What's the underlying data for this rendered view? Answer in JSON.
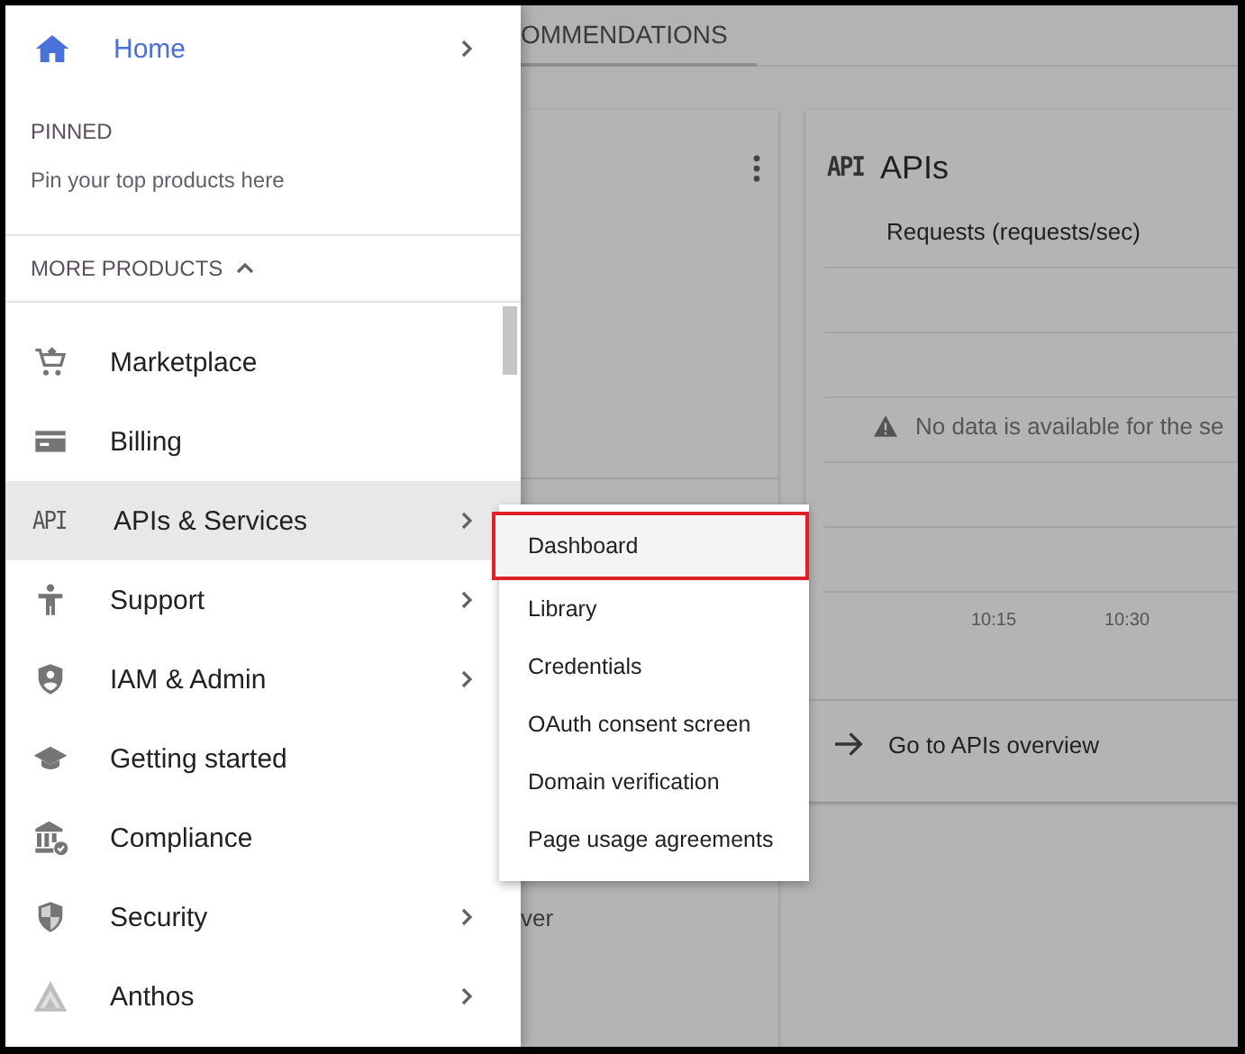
{
  "background": {
    "tab": {
      "label": "OMMENDATIONS",
      "selected": true
    },
    "left_card": {
      "text": "ver"
    },
    "apis_card": {
      "icon_text": "API",
      "title": "APIs",
      "chart_title": "Requests (requests/sec)",
      "message": "No data is available for the se",
      "x_labels": [
        "10:15",
        "10:30"
      ],
      "link": "Go to APIs overview"
    }
  },
  "drawer": {
    "home": {
      "label": "Home"
    },
    "pinned": {
      "heading": "PINNED",
      "hint": "Pin your top products here"
    },
    "more_products": {
      "label": "MORE PRODUCTS",
      "expanded": true
    },
    "items": [
      {
        "label": "Marketplace",
        "kind": "cart",
        "selected": false,
        "has_submenu": false
      },
      {
        "label": "Billing",
        "kind": "card",
        "selected": false,
        "has_submenu": false
      },
      {
        "label": "APIs & Services",
        "kind": "api",
        "icon_text": "API",
        "selected": true,
        "has_submenu": true
      },
      {
        "label": "Support",
        "kind": "person",
        "selected": false,
        "has_submenu": true
      },
      {
        "label": "IAM & Admin",
        "kind": "shield-person",
        "selected": false,
        "has_submenu": true
      },
      {
        "label": "Getting started",
        "kind": "cap",
        "selected": false,
        "has_submenu": false
      },
      {
        "label": "Compliance",
        "kind": "bank",
        "selected": false,
        "has_submenu": false
      },
      {
        "label": "Security",
        "kind": "shield",
        "selected": false,
        "has_submenu": true
      },
      {
        "label": "Anthos",
        "kind": "triangle",
        "selected": false,
        "has_submenu": true
      }
    ]
  },
  "submenu": {
    "items": [
      {
        "label": "Dashboard",
        "highlighted": true
      },
      {
        "label": "Library",
        "highlighted": false
      },
      {
        "label": "Credentials",
        "highlighted": false
      },
      {
        "label": "OAuth consent screen",
        "highlighted": false
      },
      {
        "label": "Domain verification",
        "highlighted": false
      },
      {
        "label": "Page usage agreements",
        "highlighted": false
      }
    ]
  }
}
